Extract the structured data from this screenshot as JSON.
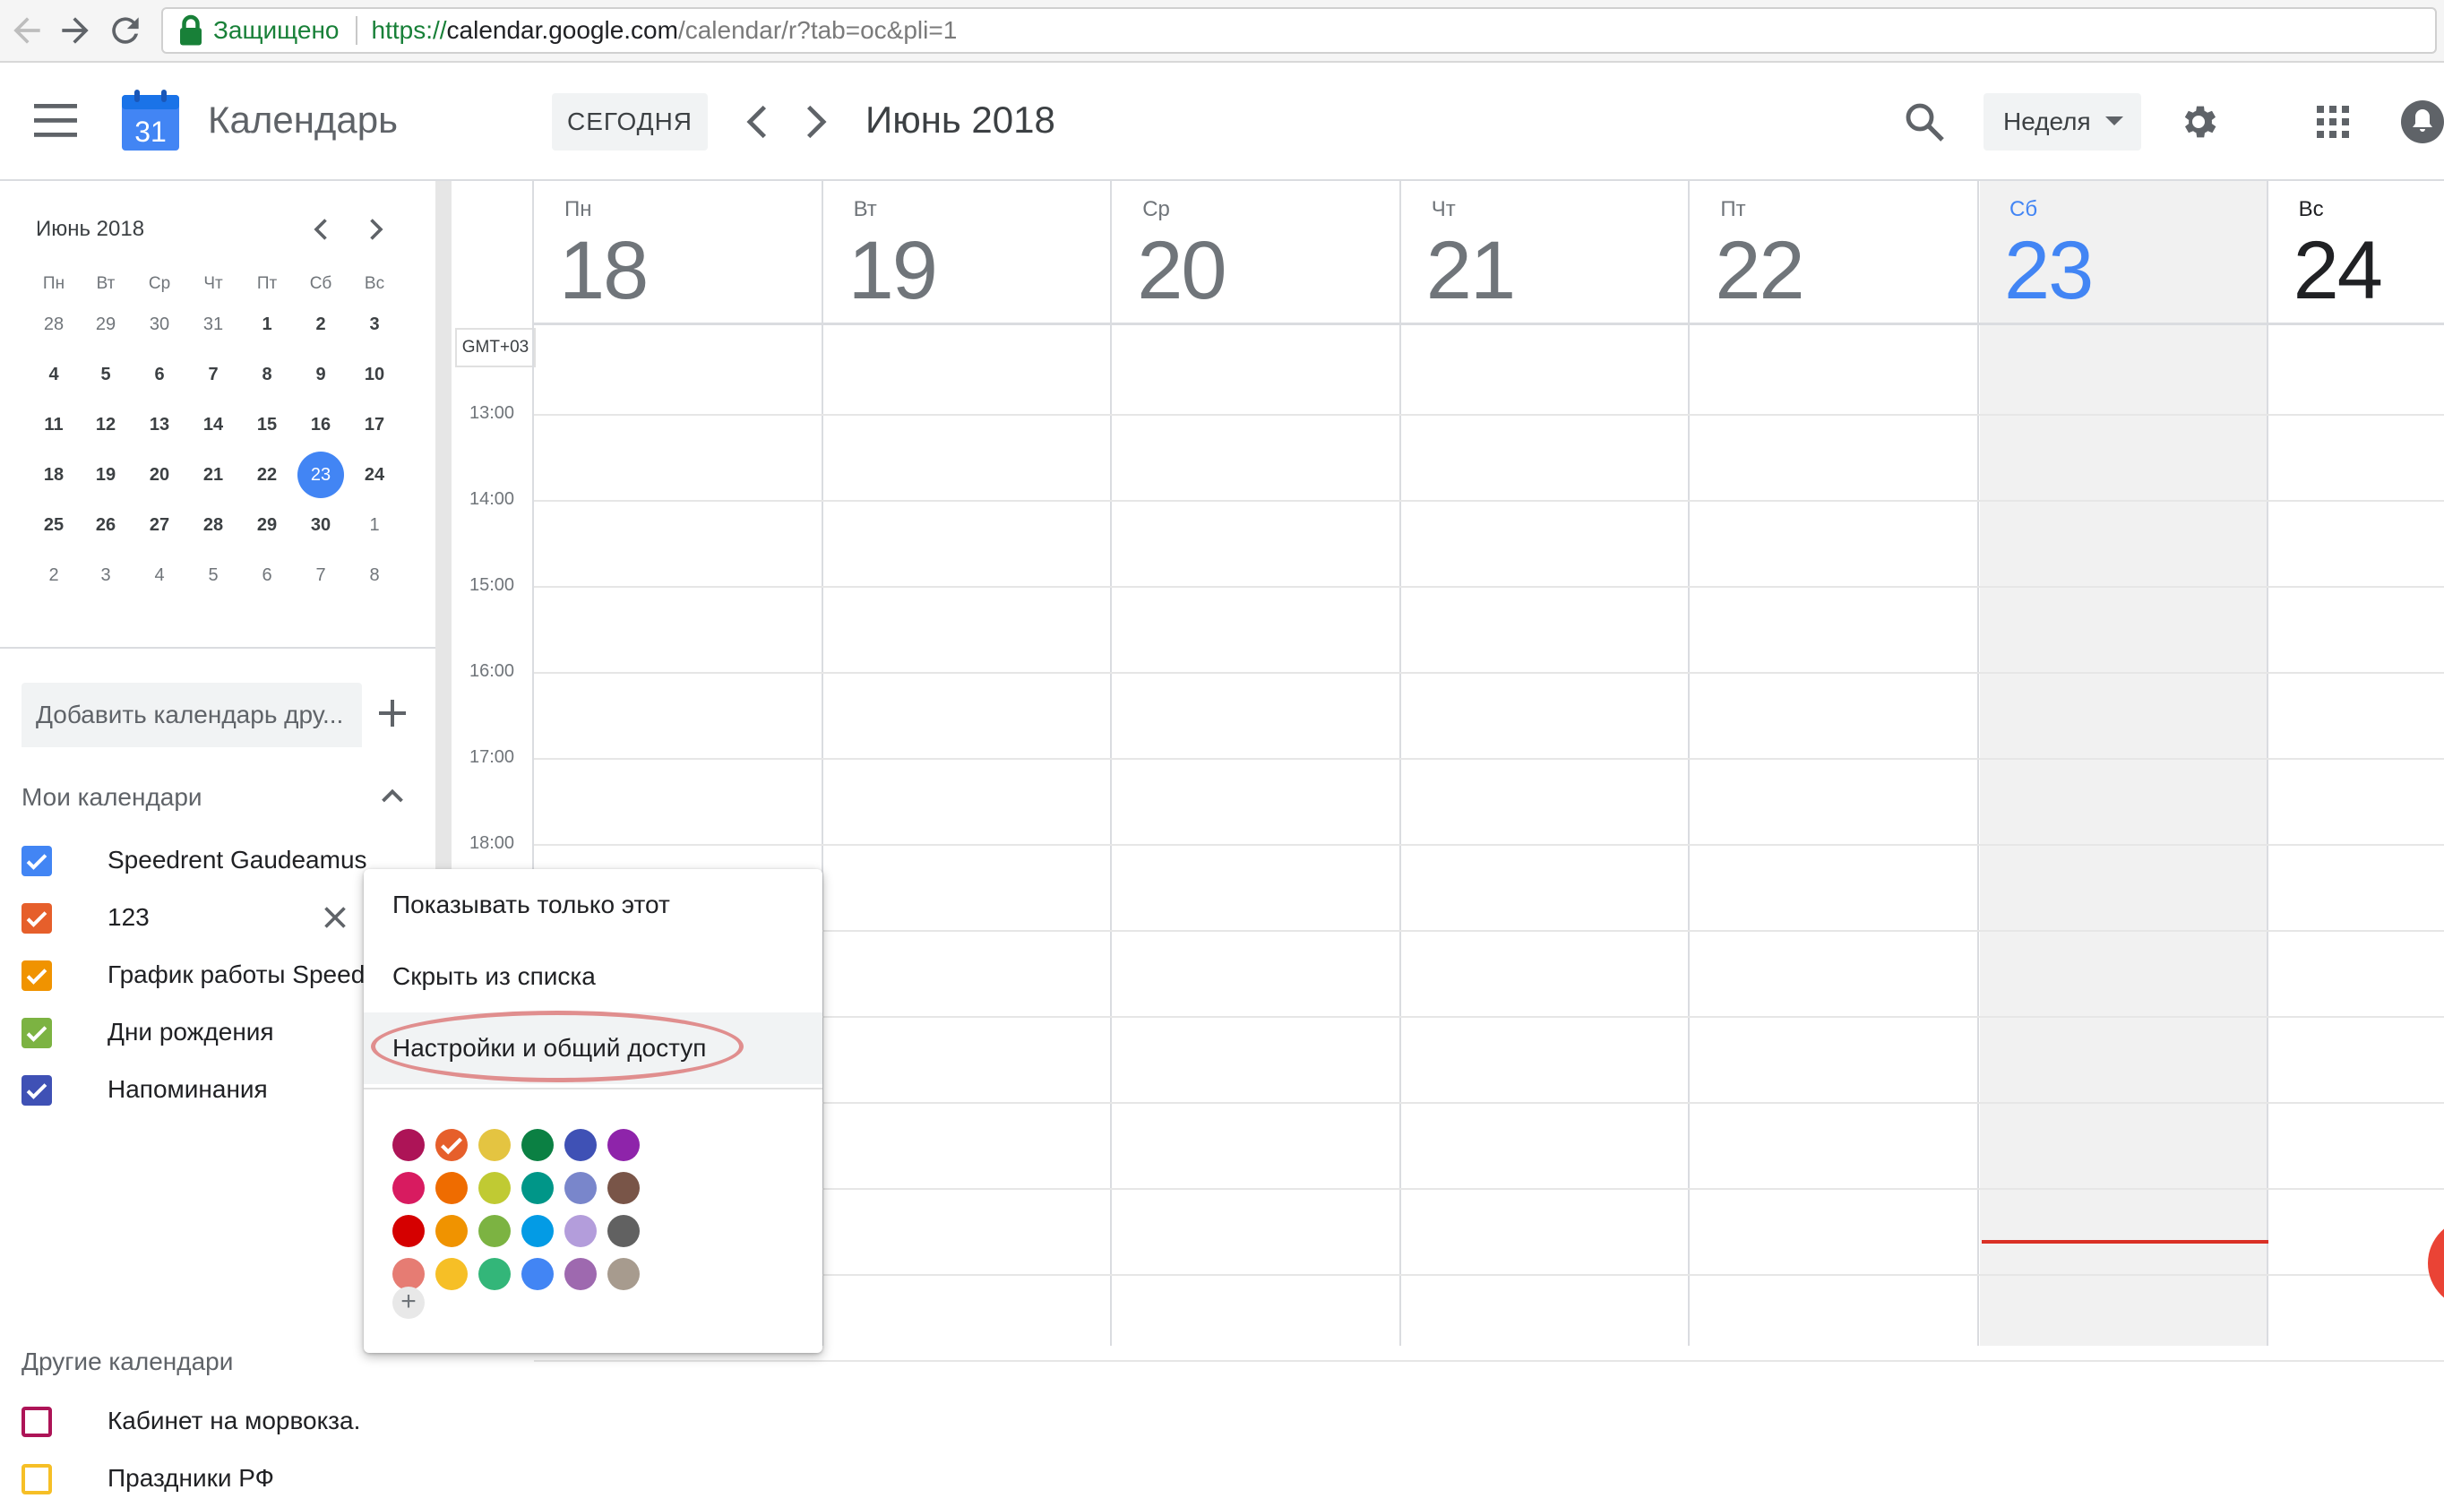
{
  "browser": {
    "secure_label": "Защищено",
    "url_scheme": "https://",
    "url_host": "calendar.google.com",
    "url_path": "/calendar/r?tab=oc&pli=1"
  },
  "header": {
    "app_title": "Календарь",
    "logo_number": "31",
    "today_label": "СЕГОДНЯ",
    "current_period": "Июнь 2018",
    "view_label": "Неделя"
  },
  "mini_calendar": {
    "title": "Июнь 2018",
    "weekday_headers": [
      "Пн",
      "Вт",
      "Ср",
      "Чт",
      "Пт",
      "Сб",
      "Вс"
    ],
    "weeks": [
      [
        "28",
        "29",
        "30",
        "31",
        "1",
        "2",
        "3"
      ],
      [
        "4",
        "5",
        "6",
        "7",
        "8",
        "9",
        "10"
      ],
      [
        "11",
        "12",
        "13",
        "14",
        "15",
        "16",
        "17"
      ],
      [
        "18",
        "19",
        "20",
        "21",
        "22",
        "23",
        "24"
      ],
      [
        "25",
        "26",
        "27",
        "28",
        "29",
        "30",
        "1"
      ],
      [
        "2",
        "3",
        "4",
        "5",
        "6",
        "7",
        "8"
      ]
    ],
    "today": "23"
  },
  "sidebar": {
    "add_calendar_placeholder": "Добавить календарь дру...",
    "my_calendars_title": "Мои календари",
    "my_calendars": [
      {
        "label": "Speedrent Gaudeamus",
        "color": "#4285f4",
        "checked": true
      },
      {
        "label": "123",
        "color": "#e65f2b",
        "checked": true
      },
      {
        "label": "График работы Speed",
        "color": "#f09300",
        "checked": true
      },
      {
        "label": "Дни рождения",
        "color": "#7cb342",
        "checked": true
      },
      {
        "label": "Напоминания",
        "color": "#3f51b5",
        "checked": true
      }
    ],
    "other_calendars_title": "Другие календари",
    "other_calendars": [
      {
        "label": "Кабинет на морвокза.",
        "color": "#ad1457",
        "checked": false
      },
      {
        "label": "Праздники РФ",
        "color": "#f6bf26",
        "checked": false
      }
    ]
  },
  "week": {
    "days": [
      {
        "dow": "Пн",
        "num": "18"
      },
      {
        "dow": "Вт",
        "num": "19"
      },
      {
        "dow": "Ср",
        "num": "20"
      },
      {
        "dow": "Чт",
        "num": "21"
      },
      {
        "dow": "Пт",
        "num": "22"
      },
      {
        "dow": "Сб",
        "num": "23"
      },
      {
        "dow": "Вс",
        "num": "24"
      }
    ],
    "timezone": "GMT+03",
    "hours": [
      "13:00",
      "14:00",
      "15:00",
      "16:00",
      "17:00",
      "18:00"
    ]
  },
  "context_menu": {
    "items": [
      "Показывать только этот",
      "Скрыть из списка",
      "Настройки и общий доступ"
    ],
    "colors": [
      [
        "#ad1457",
        "#e65f2b",
        "#e4c441",
        "#0b8043",
        "#3f51b5",
        "#8e24aa"
      ],
      [
        "#d81b60",
        "#ef6c00",
        "#c0ca33",
        "#009688",
        "#7986cb",
        "#795548"
      ],
      [
        "#d50000",
        "#f09300",
        "#7cb342",
        "#039be5",
        "#b39ddb",
        "#616161"
      ],
      [
        "#e67c73",
        "#f6bf26",
        "#33b679",
        "#4285f4",
        "#9e69af",
        "#a79b8e"
      ]
    ],
    "selected_color": "#e65f2b",
    "add_color_label": "+"
  },
  "accent": "#4285f4",
  "now_line_color": "#d93025"
}
